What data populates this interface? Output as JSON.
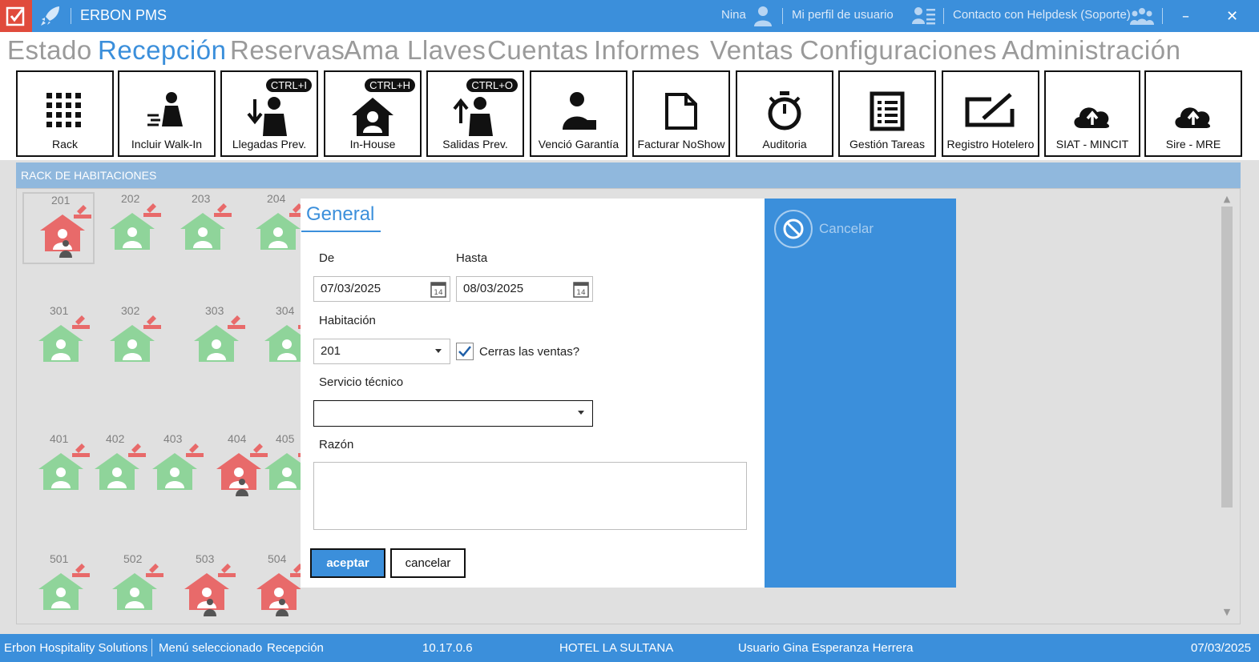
{
  "titlebar": {
    "title": "ERBON PMS",
    "user": "Nina",
    "profile": "Mi perfil de usuario",
    "helpdesk": "Contacto con Helpdesk (Soporte)",
    "minimize": "–",
    "close": "✕"
  },
  "menu": [
    "Estado",
    "Recepción",
    "Reservas",
    "Ama Llaves",
    "Cuentas",
    "Informes",
    "Ventas",
    "Configuraciones",
    "Administración"
  ],
  "menu_active": "Recepción",
  "toolbar": [
    {
      "label": "Rack",
      "badge": ""
    },
    {
      "label": "Incluir Walk-In",
      "badge": ""
    },
    {
      "label": "Llegadas Prev.",
      "badge": "CTRL+I"
    },
    {
      "label": "In-House",
      "badge": "CTRL+H"
    },
    {
      "label": "Salidas Prev.",
      "badge": "CTRL+O"
    },
    {
      "label": "Venció Garantía",
      "badge": ""
    },
    {
      "label": "Facturar NoShow",
      "badge": ""
    },
    {
      "label": "Auditoria",
      "badge": ""
    },
    {
      "label": "Gestión Tareas",
      "badge": ""
    },
    {
      "label": "Registro Hotelero",
      "badge": ""
    },
    {
      "label": "SIAT - MINCIT",
      "badge": ""
    },
    {
      "label": "Sire - MRE",
      "badge": ""
    }
  ],
  "rack": {
    "header": "RACK DE HABITACIONES",
    "rooms": [
      {
        "num": "201",
        "status": "occupied"
      },
      {
        "num": "202",
        "status": "free"
      },
      {
        "num": "203",
        "status": "free"
      },
      {
        "num": "204",
        "status": "free"
      },
      {
        "num": "301",
        "status": "free"
      },
      {
        "num": "302",
        "status": "free"
      },
      {
        "num": "303",
        "status": "free"
      },
      {
        "num": "304",
        "status": "free"
      },
      {
        "num": "401",
        "status": "free"
      },
      {
        "num": "402",
        "status": "free"
      },
      {
        "num": "403",
        "status": "free"
      },
      {
        "num": "404",
        "status": "occupied"
      },
      {
        "num": "405",
        "status": "free"
      },
      {
        "num": "501",
        "status": "free"
      },
      {
        "num": "502",
        "status": "free"
      },
      {
        "num": "503",
        "status": "occupied"
      },
      {
        "num": "504",
        "status": "occupied"
      }
    ]
  },
  "dialog": {
    "tab": "General",
    "de_label": "De",
    "de_value": "07/03/2025",
    "hasta_label": "Hasta",
    "hasta_value": "08/03/2025",
    "habitacion_label": "Habitación",
    "habitacion_value": "201",
    "cerrar_ventas_label": "Cerras las ventas?",
    "cerrar_ventas_checked": true,
    "servicio_label": "Servicio técnico",
    "servicio_value": "",
    "razon_label": "Razón",
    "razon_value": "",
    "accept": "aceptar",
    "cancel": "cancelar",
    "side_cancel": "Cancelar"
  },
  "statusbar": {
    "company": "Erbon Hospitality Solutions",
    "menu_sel_label": "Menú seleccionado",
    "menu_sel_value": "Recepción",
    "version": "10.17.0.6",
    "hotel": "HOTEL LA SULTANA",
    "user": "Usuario Gina Esperanza Herrera",
    "date": "07/03/2025"
  },
  "colors": {
    "accent": "#3b8fdb",
    "logo_red": "#e04b3c",
    "room_free": "#8fd49a",
    "room_occupied": "#e86a6a",
    "rack_header": "#90b8dd"
  }
}
